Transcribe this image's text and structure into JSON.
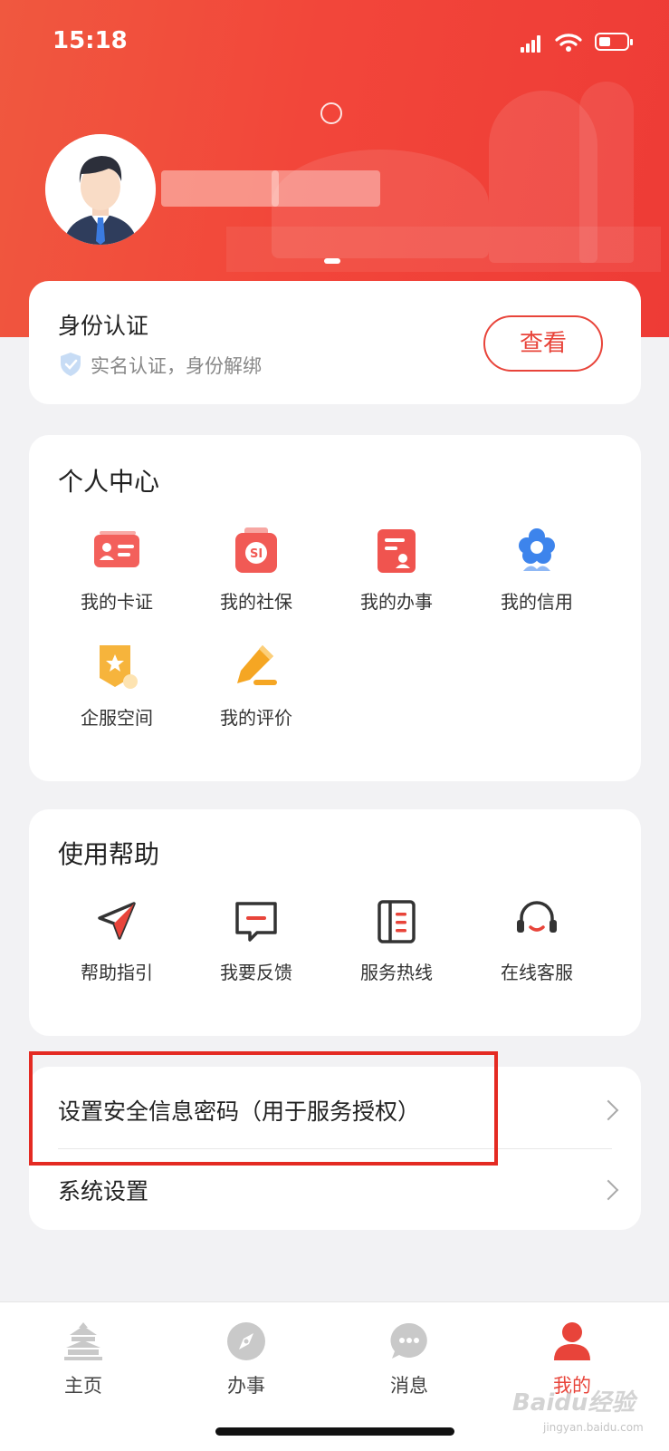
{
  "status_bar": {
    "time": "15:18"
  },
  "identity": {
    "title": "身份认证",
    "subtitle": "实名认证，身份解绑",
    "view_button": "查看"
  },
  "personal_center": {
    "title": "个人中心",
    "items": [
      {
        "label": "我的卡证",
        "icon": "id-card-icon"
      },
      {
        "label": "我的社保",
        "icon": "social-security-icon"
      },
      {
        "label": "我的办事",
        "icon": "affairs-doc-icon"
      },
      {
        "label": "我的信用",
        "icon": "credit-flower-icon"
      },
      {
        "label": "企服空间",
        "icon": "enterprise-star-icon"
      },
      {
        "label": "我的评价",
        "icon": "review-pen-icon"
      }
    ]
  },
  "help": {
    "title": "使用帮助",
    "items": [
      {
        "label": "帮助指引",
        "icon": "navigation-arrow-icon"
      },
      {
        "label": "我要反馈",
        "icon": "feedback-message-icon"
      },
      {
        "label": "服务热线",
        "icon": "hotline-book-icon"
      },
      {
        "label": "在线客服",
        "icon": "headset-icon"
      }
    ]
  },
  "settings_list": [
    {
      "label": "设置安全信息密码（用于服务授权）"
    },
    {
      "label": "系统设置"
    }
  ],
  "tabbar": [
    {
      "label": "主页",
      "icon": "temple-icon",
      "active": false
    },
    {
      "label": "办事",
      "icon": "compass-icon",
      "active": false
    },
    {
      "label": "消息",
      "icon": "chat-bubble-icon",
      "active": false
    },
    {
      "label": "我的",
      "icon": "person-icon",
      "active": true
    }
  ],
  "watermark": {
    "main": "Baidu经验",
    "sub": "jingyan.baidu.com"
  },
  "colors": {
    "brand_red": "#e8443a",
    "highlight_red": "#e42a22",
    "page_bg": "#f2f2f4"
  }
}
